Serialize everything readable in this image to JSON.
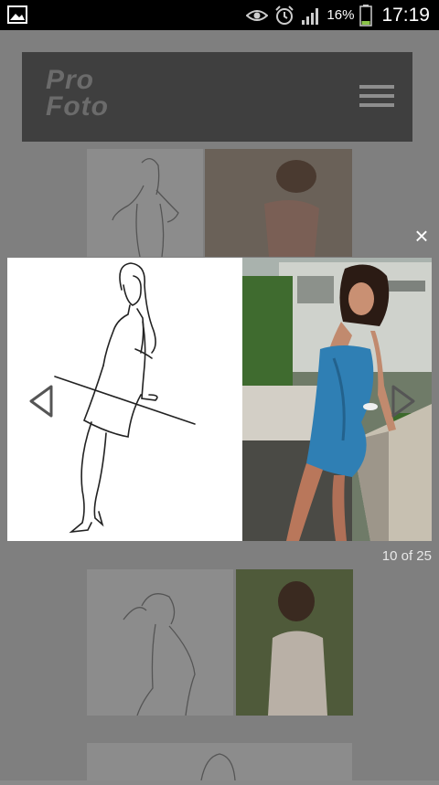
{
  "status_bar": {
    "battery_percent": "16%",
    "time": "17:19",
    "icons": [
      "gallery-icon",
      "eye-icon",
      "alarm-icon",
      "signal-icon",
      "battery-icon"
    ]
  },
  "header": {
    "logo_line1": "Pro",
    "logo_line2": "Foto",
    "menu_icon": "hamburger-menu-icon"
  },
  "lightbox": {
    "counter": "10 of 25",
    "close_label": "×",
    "prev_icon": "arrow-left-icon",
    "next_icon": "arrow-right-icon"
  },
  "colors": {
    "overlay_bg": "#7f7f7f",
    "header_bg": "#3f3f3f",
    "dress_blue": "#2f7fb4"
  }
}
